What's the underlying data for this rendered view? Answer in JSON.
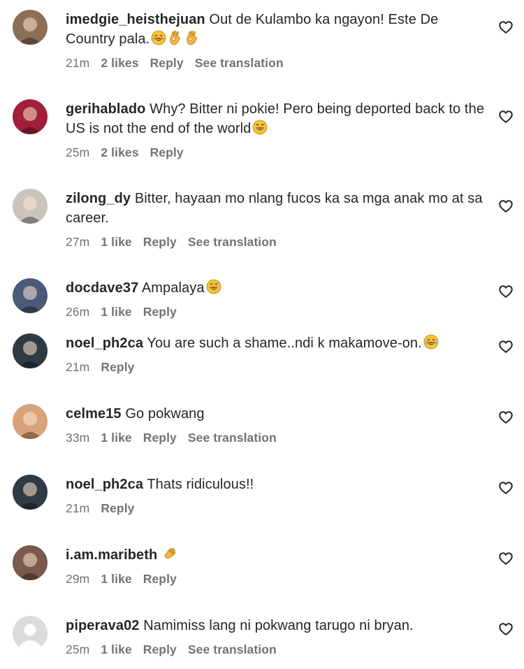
{
  "comments": [
    {
      "username": "imedgie_heisthejuan",
      "text": "Out de Kulambo ka ngayon! Este De Country pala.",
      "emojis": [
        "laughing-face",
        "ok-hand",
        "ok-hand"
      ],
      "time": "21m",
      "likes": "2 likes",
      "reply": "Reply",
      "translation": "See translation",
      "avatar_color": "#8c6f57"
    },
    {
      "username": "gerihablado",
      "text": "Why? Bitter ni pokie! Pero being deported back to the US is not the end of the world",
      "emojis": [
        "grinning-sweat-face"
      ],
      "time": "25m",
      "likes": "2 likes",
      "reply": "Reply",
      "translation": "",
      "avatar_color": "#a0203a"
    },
    {
      "username": "zilong_dy",
      "text": "Bitter, hayaan mo nlang fucos ka sa mga anak mo at sa career.",
      "emojis": [],
      "time": "27m",
      "likes": "1 like",
      "reply": "Reply",
      "translation": "See translation",
      "avatar_color": "#c9c4bd"
    },
    {
      "username": "docdave37",
      "text": "Ampalaya",
      "emojis": [
        "grinning-sweat-face"
      ],
      "time": "26m",
      "likes": "1 like",
      "reply": "Reply",
      "translation": "",
      "avatar_color": "#4a5a78"
    },
    {
      "username": "noel_ph2ca",
      "text": "You are such a shame..ndi k makamove-on.",
      "emojis": [
        "laughing-face"
      ],
      "time": "21m",
      "likes": "",
      "reply": "Reply",
      "translation": "",
      "avatar_color": "#2f3a44"
    },
    {
      "username": "celme15",
      "text": "Go pokwang",
      "emojis": [],
      "time": "33m",
      "likes": "1 like",
      "reply": "Reply",
      "translation": "See translation",
      "avatar_color": "#d8a37a"
    },
    {
      "username": "noel_ph2ca",
      "text": "Thats ridiculous!!",
      "emojis": [],
      "time": "21m",
      "likes": "",
      "reply": "Reply",
      "translation": "",
      "avatar_color": "#2f3a44"
    },
    {
      "username": "i.am.maribeth",
      "text": "",
      "emojis": [
        "clapping-hands"
      ],
      "time": "29m",
      "likes": "1 like",
      "reply": "Reply",
      "translation": "",
      "avatar_color": "#7a5a4c"
    },
    {
      "username": "piperava02",
      "text": "Namimiss lang ni pokwang tarugo ni bryan.",
      "emojis": [],
      "time": "25m",
      "likes": "1 like",
      "reply": "Reply",
      "translation": "See translation",
      "avatar_color": "#dbdbdb"
    }
  ]
}
